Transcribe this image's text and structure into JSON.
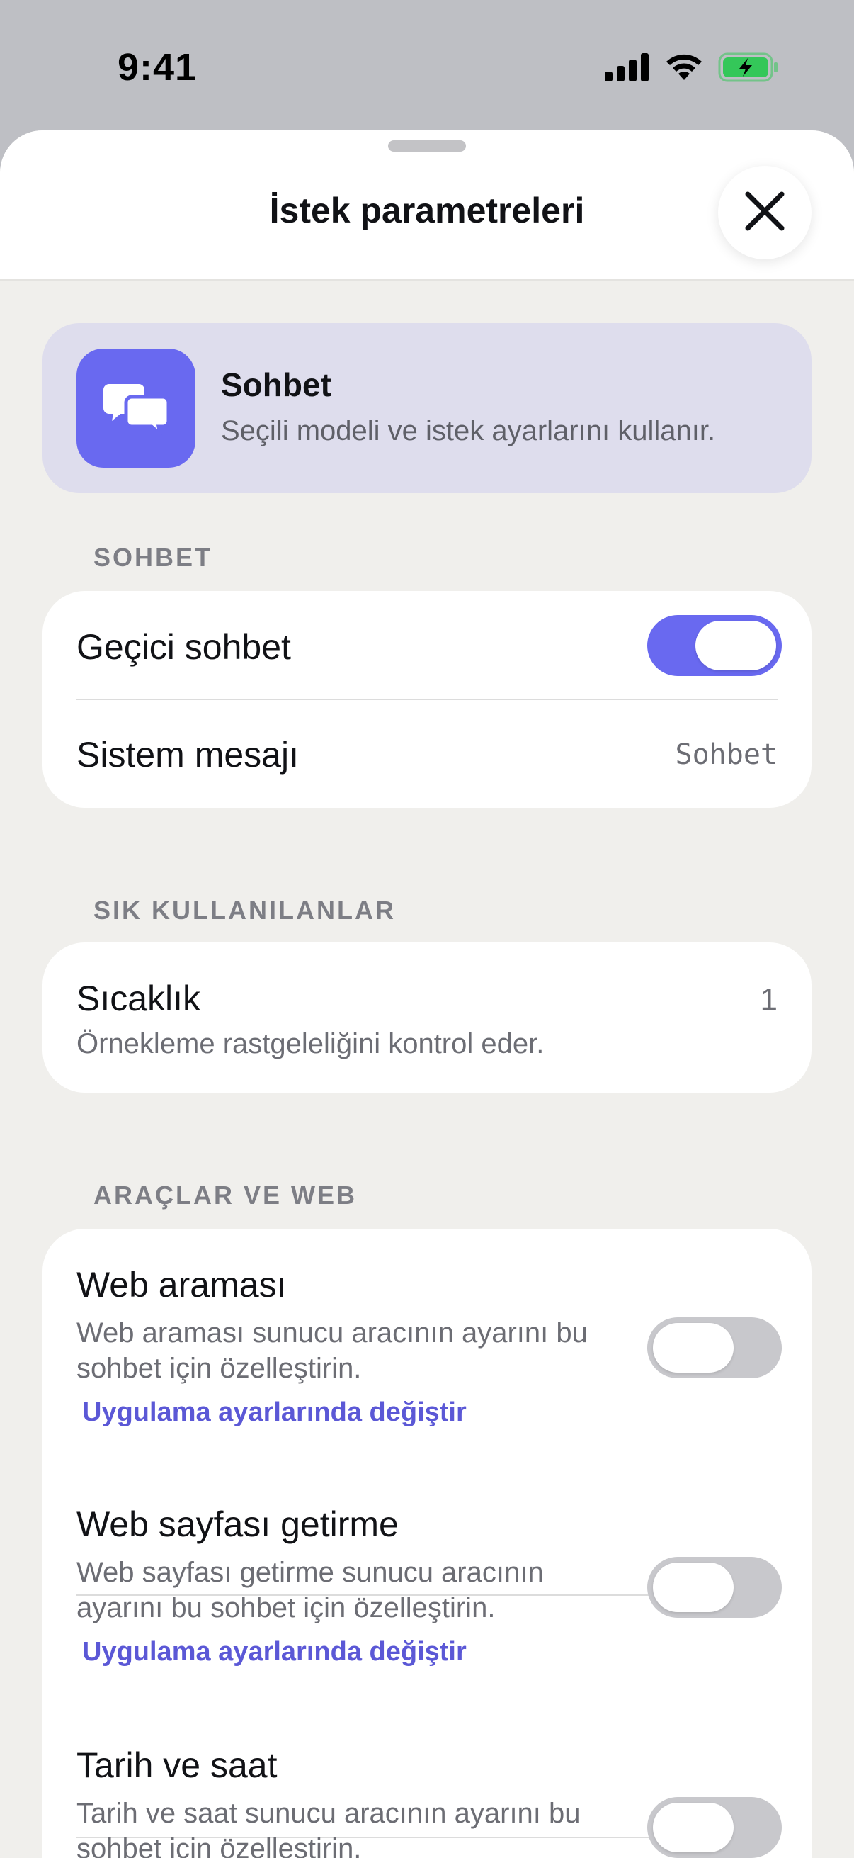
{
  "status_bar": {
    "time": "9:41",
    "icons": [
      "cellular-signal-icon",
      "wifi-icon",
      "battery-charging-icon"
    ],
    "battery_color": "#34c759"
  },
  "sheet": {
    "title": "İstek parametreleri",
    "close_icon": "close-icon"
  },
  "mode": {
    "icon": "chat-bubbles-icon",
    "title": "Sohbet",
    "description": "Seçili modeli ve istek ayarlarını kullanır."
  },
  "sections": {
    "chat": {
      "label": "SOHBET",
      "temporary_chat": {
        "label": "Geçici sohbet",
        "enabled": true
      },
      "system_message": {
        "label": "Sistem mesajı",
        "value": "Sohbet"
      }
    },
    "favorites": {
      "label": "SIK KULLANILANLAR",
      "temperature": {
        "label": "Sıcaklık",
        "description": "Örnekleme rastgeleliğini kontrol eder.",
        "value": "1"
      }
    },
    "tools": {
      "label": "ARAÇLAR VE WEB",
      "items": [
        {
          "label": "Web araması",
          "description_line1": "Web araması sunucu aracının ayarını bu",
          "description_line2": "sohbet için özelleştirin.",
          "link": "Uygulama ayarlarında değiştir",
          "enabled": false
        },
        {
          "label": "Web sayfası getirme",
          "description_line1": "Web sayfası getirme sunucu aracının",
          "description_line2": "ayarını bu sohbet için özelleştirin.",
          "link": "Uygulama ayarlarında değiştir",
          "enabled": false
        },
        {
          "label": "Tarih ve saat",
          "description_line1": "Tarih ve saat sunucu aracının ayarını bu",
          "description_line2": "sohbet için özelleştirin.",
          "enabled": false
        }
      ]
    }
  },
  "colors": {
    "accent": "#6969f0",
    "link": "#5b58d6",
    "mode_card_bg": "#dedded",
    "toggle_off": "#c8c8cc"
  }
}
